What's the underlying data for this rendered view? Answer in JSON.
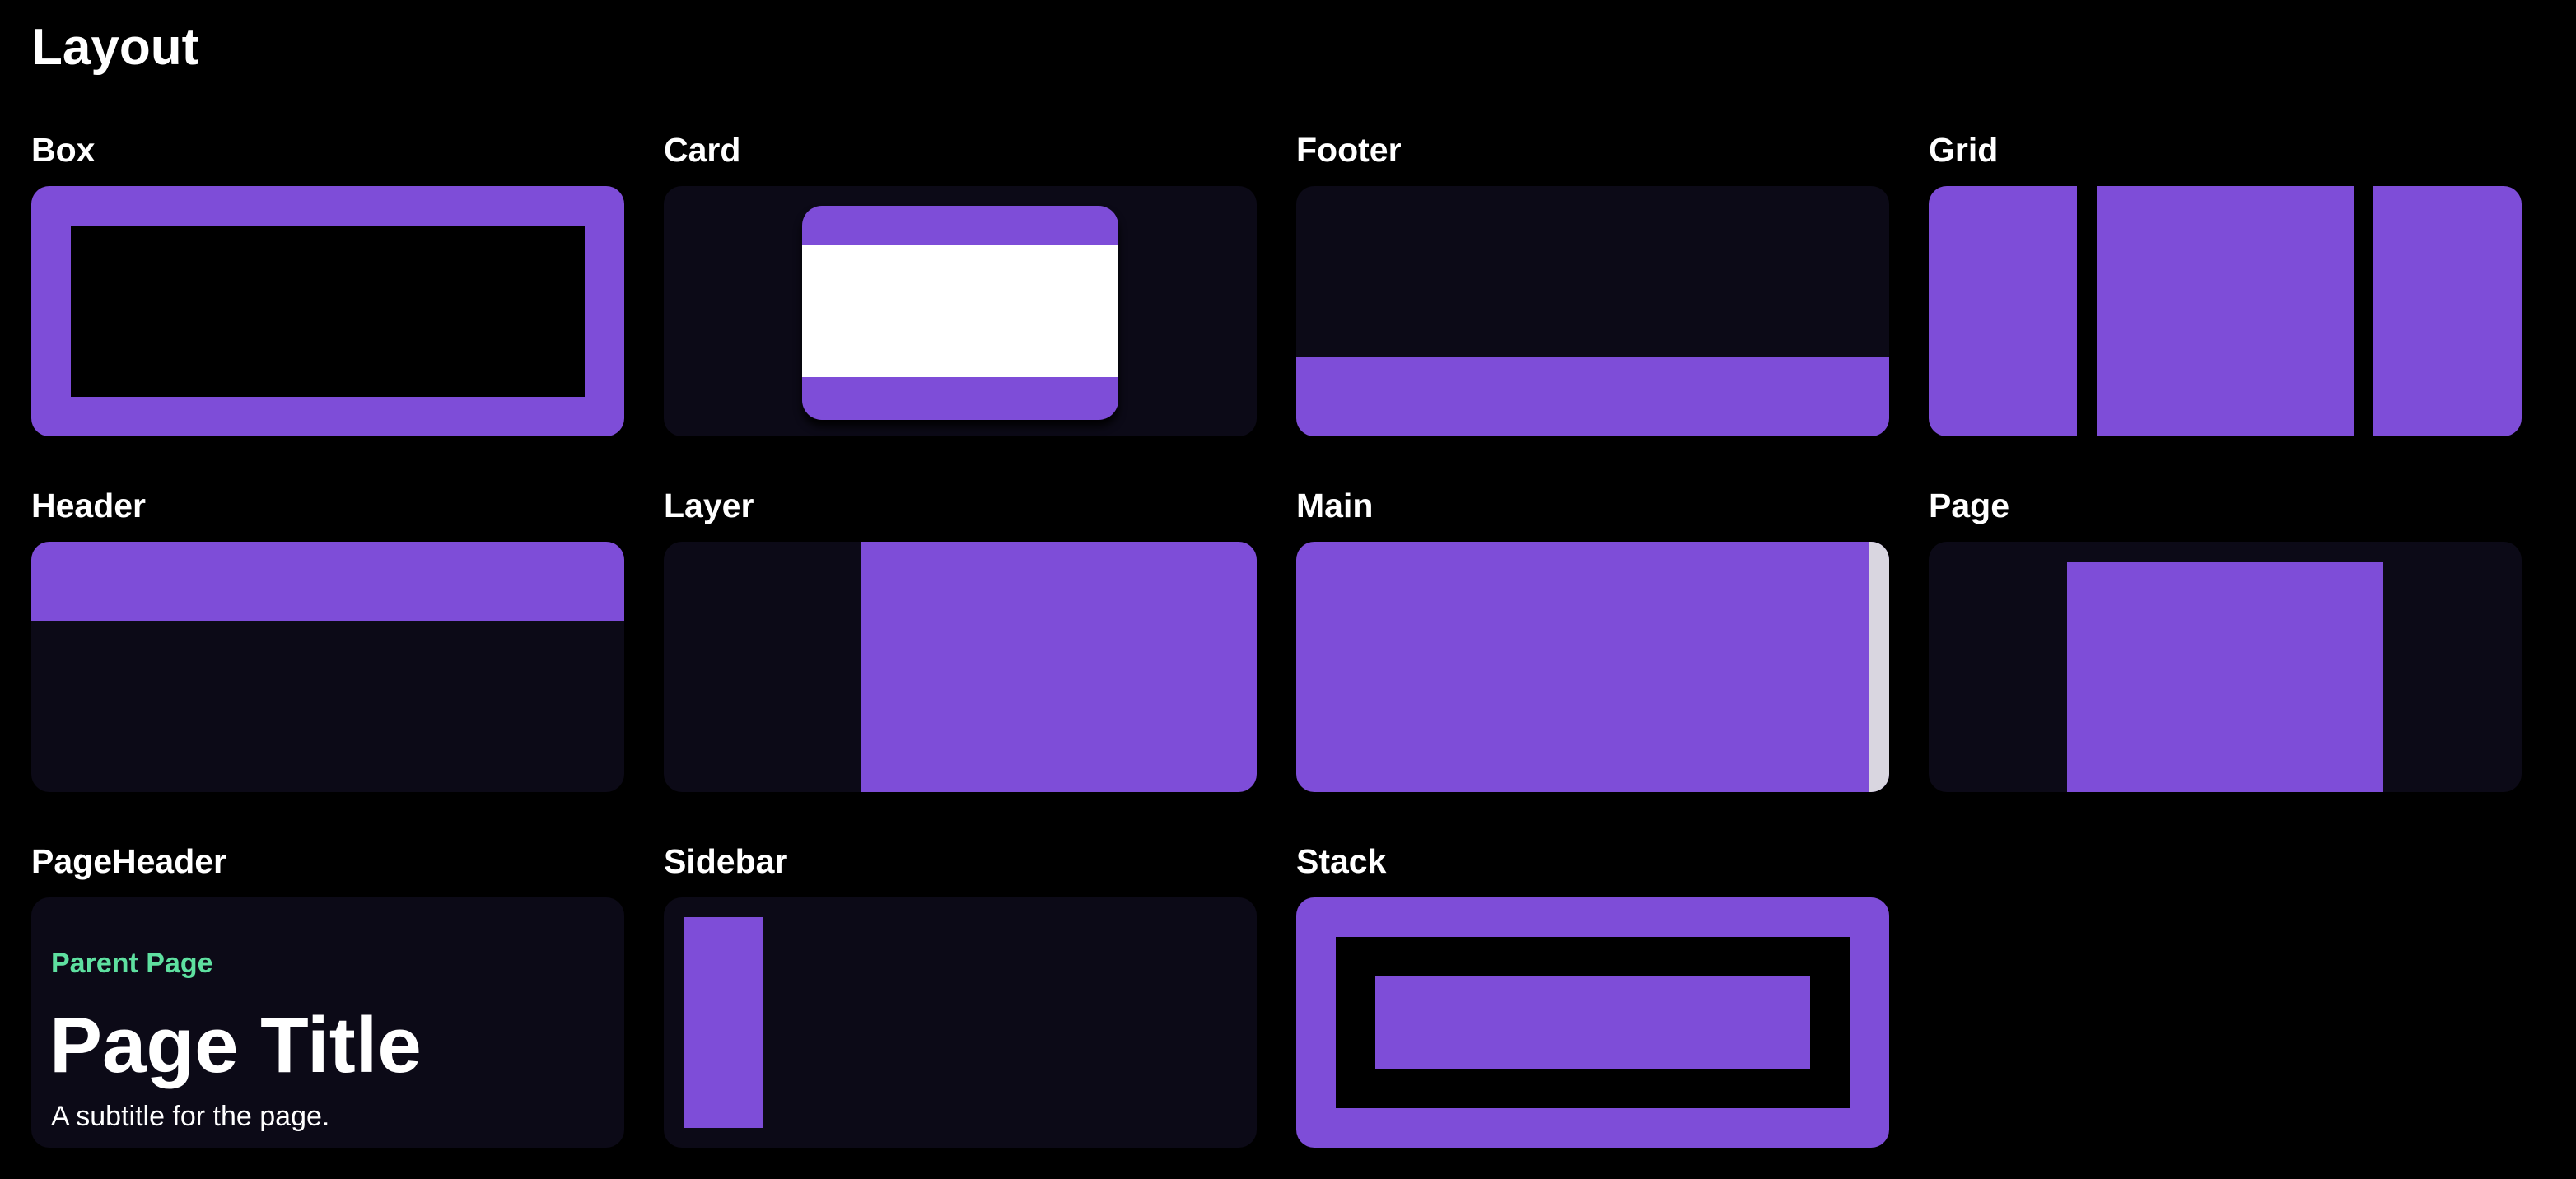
{
  "page": {
    "title": "Layout"
  },
  "components": {
    "box": {
      "label": "Box"
    },
    "card": {
      "label": "Card"
    },
    "footer": {
      "label": "Footer"
    },
    "grid": {
      "label": "Grid"
    },
    "header": {
      "label": "Header"
    },
    "layer": {
      "label": "Layer"
    },
    "main": {
      "label": "Main"
    },
    "page": {
      "label": "Page"
    },
    "pageheader": {
      "label": "PageHeader",
      "parent_link": "Parent Page",
      "title": "Page Title",
      "subtitle": "A subtitle for the page."
    },
    "sidebar": {
      "label": "Sidebar"
    },
    "stack": {
      "label": "Stack"
    }
  },
  "colors": {
    "background": "#000000",
    "preview_surface": "#0c0a17",
    "accent_purple": "#7e4dd8",
    "parent_link_green": "#5ee0a0",
    "card_white": "#ffffff",
    "scrollbar": "#d9d6e0"
  }
}
